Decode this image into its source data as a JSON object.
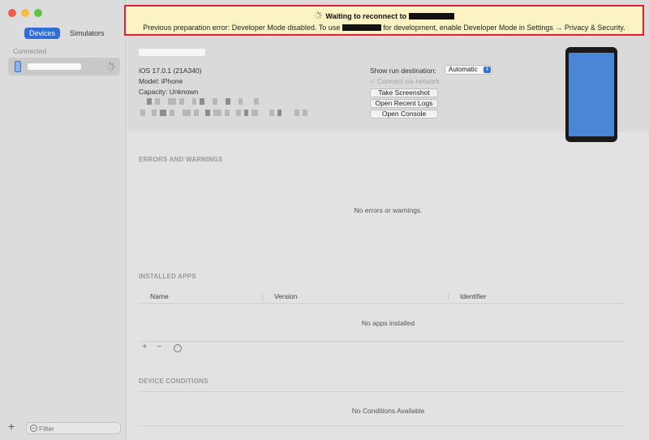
{
  "sidebar": {
    "tabs": [
      {
        "label": "Devices",
        "active": true
      },
      {
        "label": "Simulators",
        "active": false
      }
    ],
    "section_label": "Connected",
    "filter_placeholder": "Filter",
    "add_icon": "plus-icon"
  },
  "banner": {
    "title": "Waiting to reconnect to",
    "message_part1": "Previous preparation error: Developer Mode disabled. To use",
    "message_part2": "for development, enable Developer Mode in Settings → Privacy & Security.",
    "border_color": "#e0203a",
    "background_color": "#fbf3c3"
  },
  "device": {
    "ios": "iOS 17.0.1 (21A340)",
    "model": "Model: iPhone",
    "capacity": "Capacity: Unknown"
  },
  "run_destination": {
    "label": "Show run destination:",
    "value": "Automatic",
    "connect_label": "Connect via network",
    "connect_checked": true
  },
  "actions": {
    "take_screenshot": "Take Screenshot",
    "open_recent_logs": "Open Recent Logs",
    "open_console": "Open Console"
  },
  "errors": {
    "title": "ERRORS AND WARNINGS",
    "empty": "No errors or warnings."
  },
  "apps": {
    "title": "INSTALLED APPS",
    "columns": [
      "Name",
      "Version",
      "Identifier"
    ],
    "empty": "No apps installed"
  },
  "conditions": {
    "title": "DEVICE CONDITIONS",
    "empty": "No Conditions Available"
  },
  "colors": {
    "accent": "#2f6fd3",
    "device_screen": "#4a86d6"
  }
}
